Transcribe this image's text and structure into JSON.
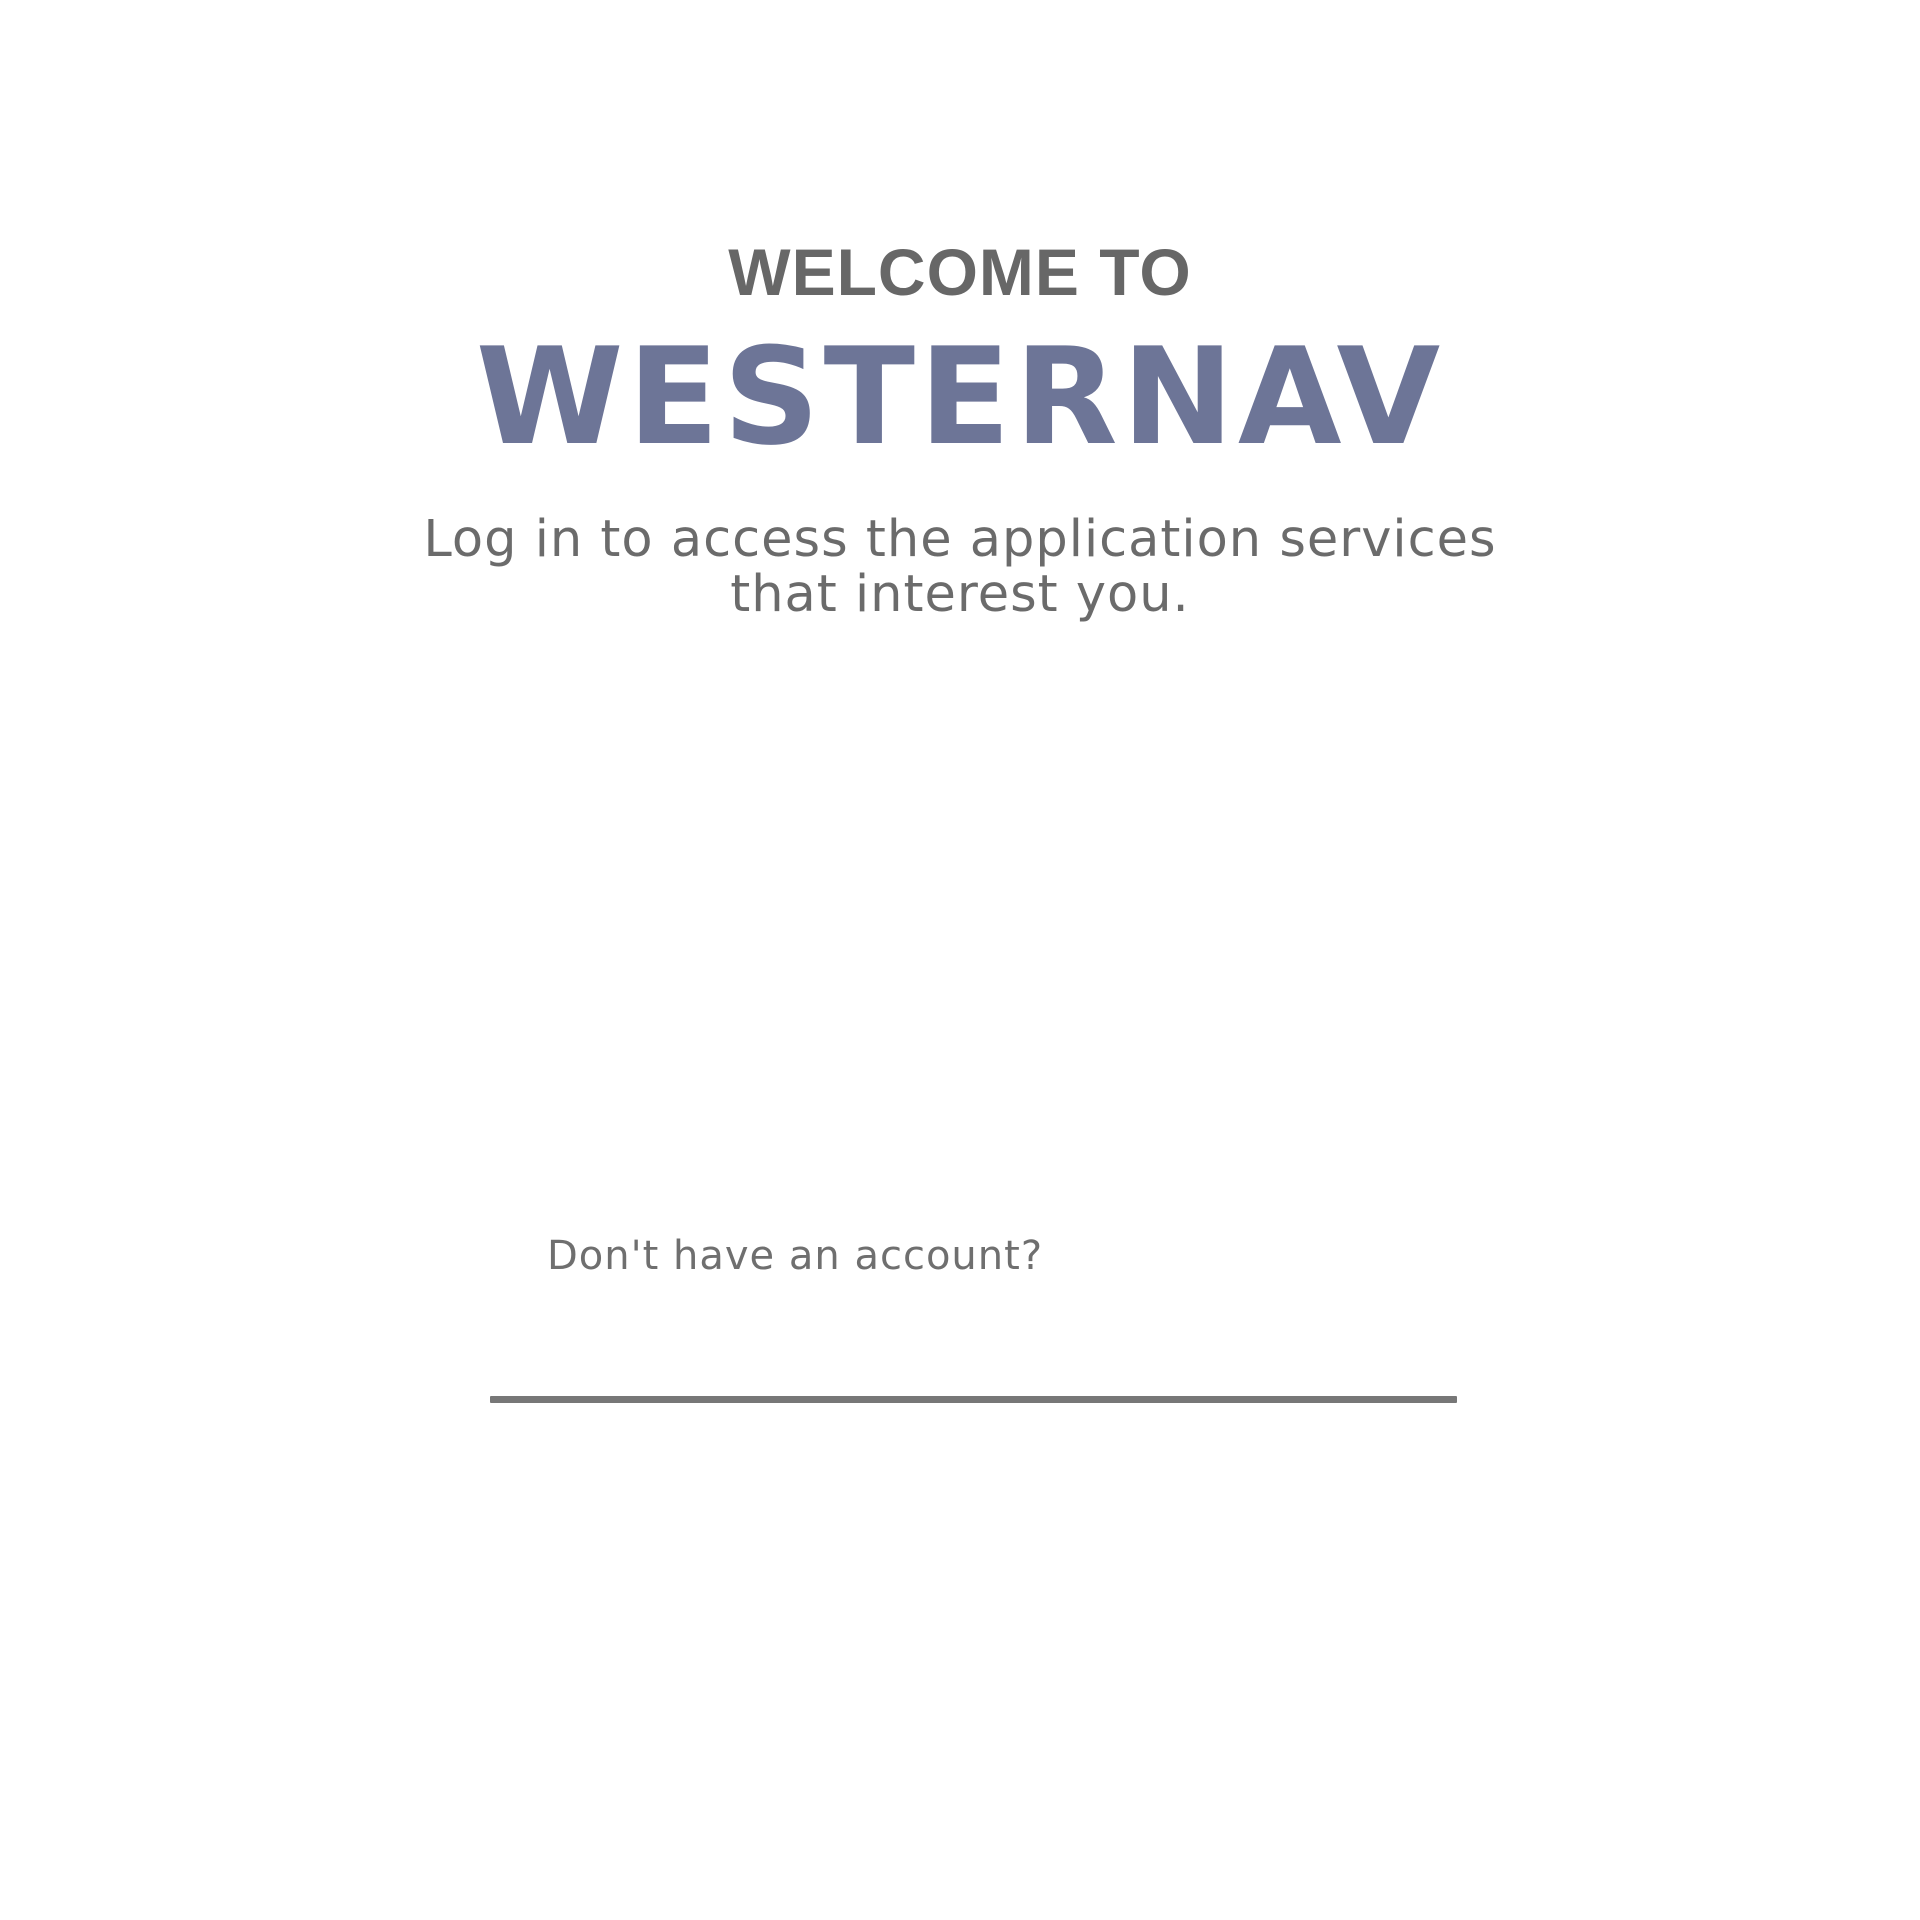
{
  "header": {
    "welcome_text": "WELCOME TO",
    "brand_name": "WESTERNAV",
    "subtitle_line1": "Log in to access the application services",
    "subtitle_line2": "that interest you."
  },
  "signup": {
    "prompt": "Don't have an account?"
  },
  "colors": {
    "background": "#ffffff",
    "text_gray": "#676767",
    "brand_blue": "#6d7597",
    "divider": "#777777"
  }
}
